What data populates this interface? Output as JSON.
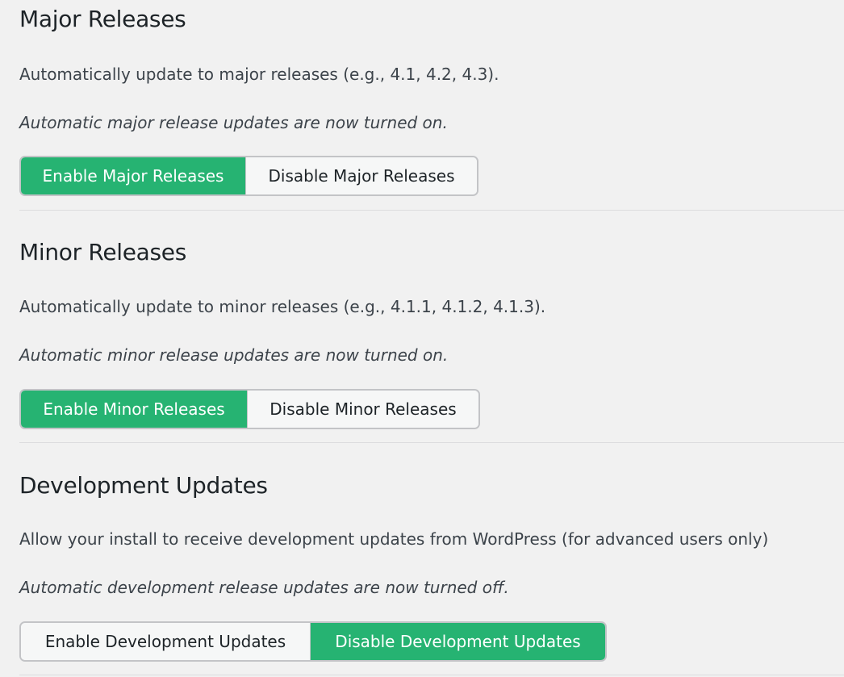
{
  "sections": [
    {
      "title": "Major Releases",
      "description": "Automatically update to major releases (e.g., 4.1, 4.2, 4.3).",
      "status": "Automatic major release updates are now turned on.",
      "enable_label": "Enable Major Releases",
      "disable_label": "Disable Major Releases",
      "enabled": true
    },
    {
      "title": "Minor Releases",
      "description": "Automatically update to minor releases (e.g., 4.1.1, 4.1.2, 4.1.3).",
      "status": "Automatic minor release updates are now turned on.",
      "enable_label": "Enable Minor Releases",
      "disable_label": "Disable Minor Releases",
      "enabled": true
    },
    {
      "title": "Development Updates",
      "description": "Allow your install to receive development updates from WordPress (for advanced users only)",
      "status": "Automatic development release updates are now turned off.",
      "enable_label": "Enable Development Updates",
      "disable_label": "Disable Development Updates",
      "enabled": false
    }
  ],
  "colors": {
    "active_button_bg": "#26b372",
    "active_button_text": "#ffffff",
    "inactive_button_bg": "#f6f7f7",
    "page_bg": "#f1f1f1",
    "divider": "#dcdcde"
  }
}
